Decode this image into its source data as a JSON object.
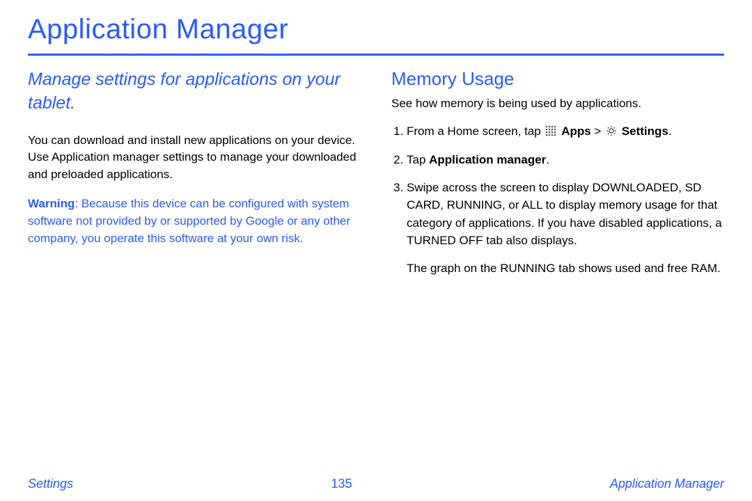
{
  "title": "Application Manager",
  "left": {
    "subtitle": "Manage settings for applications on your tablet.",
    "intro": "You can download and install new applications on your device. Use Application manager settings to manage your downloaded and preloaded applications.",
    "warning_label": "Warning",
    "warning_body": ": Because this device can be configured with system software not provided by or supported by Google or any other company, you operate this software at your own risk."
  },
  "right": {
    "heading": "Memory Usage",
    "intro": "See how memory is being used by applications.",
    "step1_pre": "From a Home screen, tap ",
    "step1_apps": "Apps",
    "step1_gt": " > ",
    "step1_settings": "Settings",
    "step1_post": ".",
    "step2_pre": "Tap ",
    "step2_bold": "Application manager",
    "step2_post": ".",
    "step3": "Swipe across the screen to display DOWNLOADED, SD CARD, RUNNING, or ALL to display memory usage for that category of applications. If you have disabled applications, a TURNED OFF tab also displays.",
    "step3_extra": "The graph on the RUNNING tab shows used and free RAM."
  },
  "footer": {
    "left": "Settings",
    "center": "135",
    "right": "Application Manager"
  }
}
